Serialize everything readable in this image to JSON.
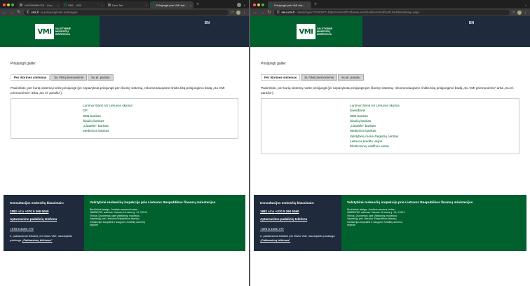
{
  "windows": [
    {
      "tabs": [
        {
          "label": "+442086684226 - Google Sear",
          "active": false
        },
        {
          "label": "VMI – VMI",
          "active": false
        },
        {
          "label": "New Tab",
          "active": false
        },
        {
          "label": "Prisijungti prie VMI sistemų",
          "active": true
        }
      ],
      "url_host": "vmi.lt",
      "url_path": "/e-prisijungimas.net/pages",
      "brand": {
        "logo": "VMI",
        "name": "Valstybinė mokesčių inspekcija"
      },
      "lang": "EN",
      "login_title": "Prisijungti galite:",
      "auth_tabs": [
        "Per išorines sistemas",
        "Su VMI priemonėmis",
        "Su el. parašu"
      ],
      "description": "Pasirinkite, per kurią sistemą norite prisijungti (jei nepavyksta prisijungti per išorinę sistemą, rekomenduojame rinktis kitą prisijungimo būdą „Su VMI priemonėmis\" arba „Su el. parašu\").",
      "banks": [
        "Luminor Bank AS Lietuvos skyrius",
        "OP",
        "SEB bankas",
        "Šiaulių bankas",
        "„Citadele\" bankas",
        "Medicinos bankas"
      ]
    },
    {
      "tabs": [
        {
          "label": "Prisijungti prie VMI sistemų",
          "active": true
        }
      ],
      "url_host": "seu.vmi.lt",
      "url_path": "/saml/login?TARGET=https%3a%2f%2fwww.vmi.lt%2fevmi%2f%2fLt%2fkeisti/step.aspx",
      "brand": {
        "logo": "VMI",
        "name": "Valstybinė mokesčių inspekcija"
      },
      "lang": "EN",
      "login_title": "Prisijungti galite:",
      "auth_tabs": [
        "Per išorines sistemas",
        "Su VMI priemonėmis",
        "Su el. parašu"
      ],
      "description": "Pasirinkite, per kurią sistemą norite prisijungti (jei nepavyksta prisijungti per išorinę sistemą, rekomenduojame rinktis kitą prisijungimo būdą „Su VMI priemonėmis\" arba „Su el. parašu\").",
      "banks": [
        "Luminor Bank AS Lietuvos skyrius",
        "Swedbank",
        "SEB bankas",
        "Šiaulių bankas",
        "„Citadele\" bankas",
        "Medicinos bankas",
        "Valstybės įmonė Registrų centras",
        "Lietuvos kredito unijos",
        "Elektroninių valdžios vartai"
      ]
    }
  ],
  "footer": {
    "question": "Konsultacijos mokesčių klausimais:",
    "phone_main": "1882",
    "phone_sep": "arba",
    "phone_alt": "+370 5 260 5060",
    "units_link": "Aptarnavimo padalinių telefonu",
    "phone_extra": "+370 5 2191 777",
    "note_prefix": "e. paklausimai teikiami per Mano VMI, naudojantis paslauga",
    "note_link": "„Paklausimų teikimas\"",
    "org_name": "Valstybinė mokesčių inspekcija prie Lietuvos Respublikos finansų ministerijos",
    "address": "Biudžetinė įstaiga, Juridinio asmens kodas – 188659752, adresas: Vasario 16-osios g. 14, 01514 Vilnius. Duomenys apie Valstybinę mokesčių inspekciją prie Lietuvos Respublikos finansų ministerijos kaupiami ir saugomi Juridinių asmenų registre"
  },
  "colors": {
    "brand_green": "#00612e",
    "brand_navy": "#1f2a3d"
  }
}
